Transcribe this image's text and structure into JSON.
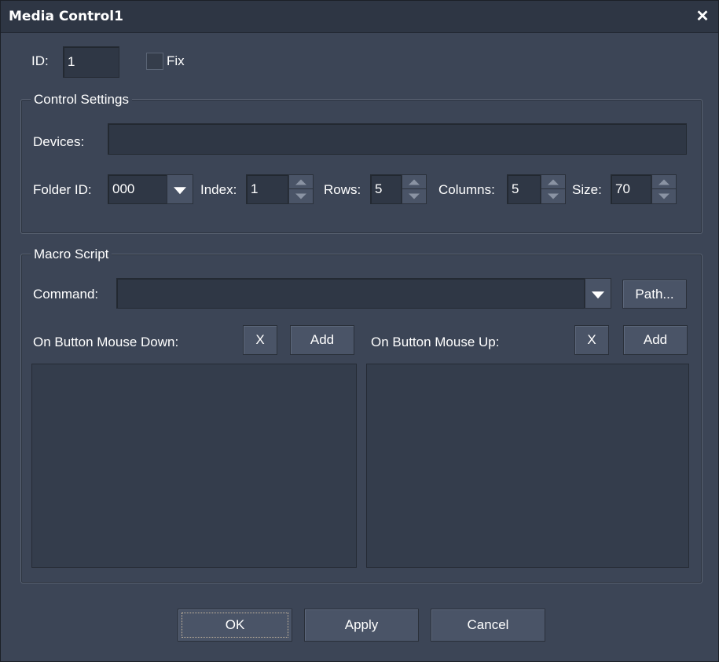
{
  "window": {
    "title": "Media Control1",
    "close_glyph": "✕"
  },
  "id_row": {
    "id_label": "ID:",
    "id_value": "1",
    "fix_label": "Fix",
    "fix_checked": false
  },
  "control_settings": {
    "title": "Control Settings",
    "devices_label": "Devices:",
    "devices_value": "",
    "folder_id_label": "Folder ID:",
    "folder_id_value": "000",
    "index_label": "Index:",
    "index_value": "1",
    "rows_label": "Rows:",
    "rows_value": "5",
    "columns_label": "Columns:",
    "columns_value": "5",
    "size_label": "Size:",
    "size_value": "70"
  },
  "macro_script": {
    "title": "Macro Script",
    "command_label": "Command:",
    "command_value": "",
    "path_button": "Path...",
    "mouse_down_label": "On Button Mouse Down:",
    "mouse_down_clear": "X",
    "mouse_down_add": "Add",
    "mouse_up_label": "On Button Mouse Up:",
    "mouse_up_clear": "X",
    "mouse_up_add": "Add"
  },
  "footer": {
    "ok": "OK",
    "apply": "Apply",
    "cancel": "Cancel"
  },
  "colors": {
    "background": "#3c4556",
    "titlebar": "#2e3644",
    "field": "#2f3745",
    "button": "#4a5467",
    "text": "#ffffff"
  }
}
